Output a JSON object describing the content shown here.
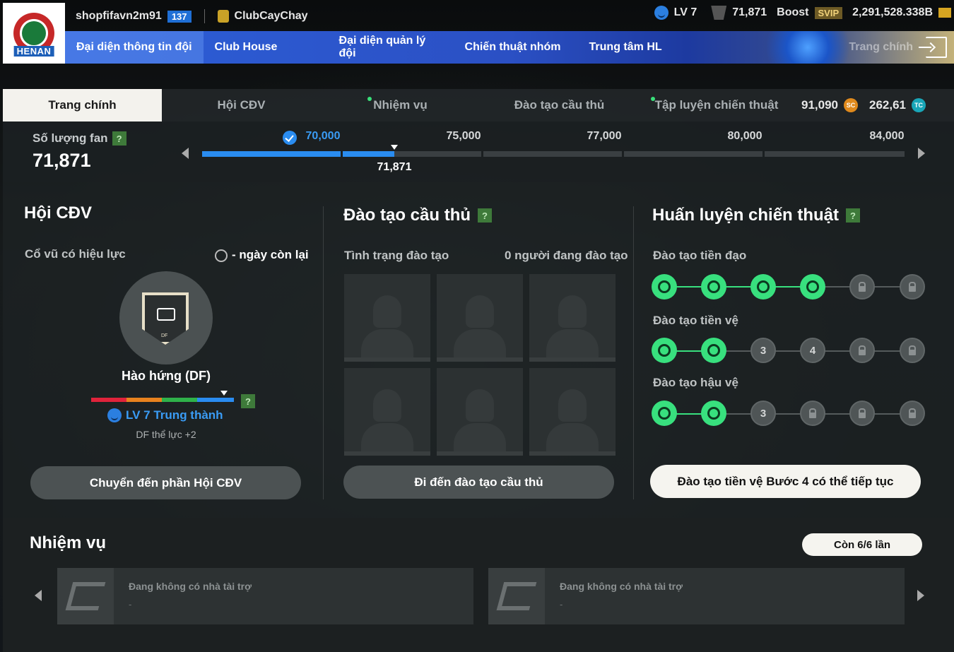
{
  "header": {
    "club_logo_text": "HENAN",
    "username": "shopfifavn2m91",
    "user_level": "137",
    "club_name": "ClubCayChay",
    "manager_level": "LV 7",
    "fans": "71,871",
    "boost_label": "Boost",
    "svip_label": "SVIP",
    "balance": "2,291,528.338B"
  },
  "nav": {
    "items": [
      {
        "label": "Đại diện thông tin đội"
      },
      {
        "label": "Club House"
      },
      {
        "label": "Đại diện quản lý đội"
      },
      {
        "label": "Chiến thuật nhóm"
      },
      {
        "label": "Trung tâm HL"
      },
      {
        "label": "Trang chính"
      }
    ]
  },
  "tabs": {
    "items": [
      {
        "label": "Trang chính"
      },
      {
        "label": "Hội CĐV"
      },
      {
        "label": "Nhiệm vụ"
      },
      {
        "label": "Đào tạo cầu thủ"
      },
      {
        "label": "Tập luyện chiến thuật"
      }
    ],
    "sc_amount": "91,090",
    "sc_icon": "SC",
    "tc_amount": "262,61",
    "tc_icon": "TC"
  },
  "fan_progress": {
    "label": "Số lượng fan",
    "value": "71,871",
    "milestones": [
      "70,000",
      "75,000",
      "77,000",
      "80,000",
      "84,000"
    ],
    "current_marker": "71,871",
    "fill_fraction_segment2": 0.37
  },
  "supporters": {
    "title": "Hội CĐV",
    "effective_label": "Cổ vũ có hiệu lực",
    "days_left": "- ngày còn lại",
    "badge_tag": "DF",
    "badge_name": "Hào hứng (DF)",
    "loyalty": "LV 7 Trung thành",
    "effect_note": "DF thể lực +2",
    "button": "Chuyển đến phần Hội CĐV"
  },
  "player_training": {
    "title": "Đào tạo cầu thủ",
    "status_label": "Tình trạng đào tạo",
    "count_label": "0 người đang đào tạo",
    "button": "Đi đến đào tạo cầu thủ"
  },
  "tactics": {
    "title": "Huấn luyện chiến thuật",
    "rows": [
      {
        "label": "Đào tạo tiền đạo"
      },
      {
        "label": "Đào tạo tiền vệ",
        "n3": "3",
        "n4": "4"
      },
      {
        "label": "Đào tạo hậu vệ",
        "n3": "3"
      }
    ],
    "button": "Đào tạo tiền vệ Bước 4 có thể tiếp tục"
  },
  "missions": {
    "title": "Nhiệm vụ",
    "remaining": "Còn 6/6 lần",
    "cards": [
      {
        "text": "Đang không có nhà tài trợ",
        "sub": "-"
      },
      {
        "text": "Đang không có nhà tài trợ",
        "sub": "-"
      }
    ]
  },
  "colors": {
    "accent_blue": "#2a8cf0",
    "accent_green": "#38e07e",
    "nav_blue": "#2d5fd8"
  }
}
